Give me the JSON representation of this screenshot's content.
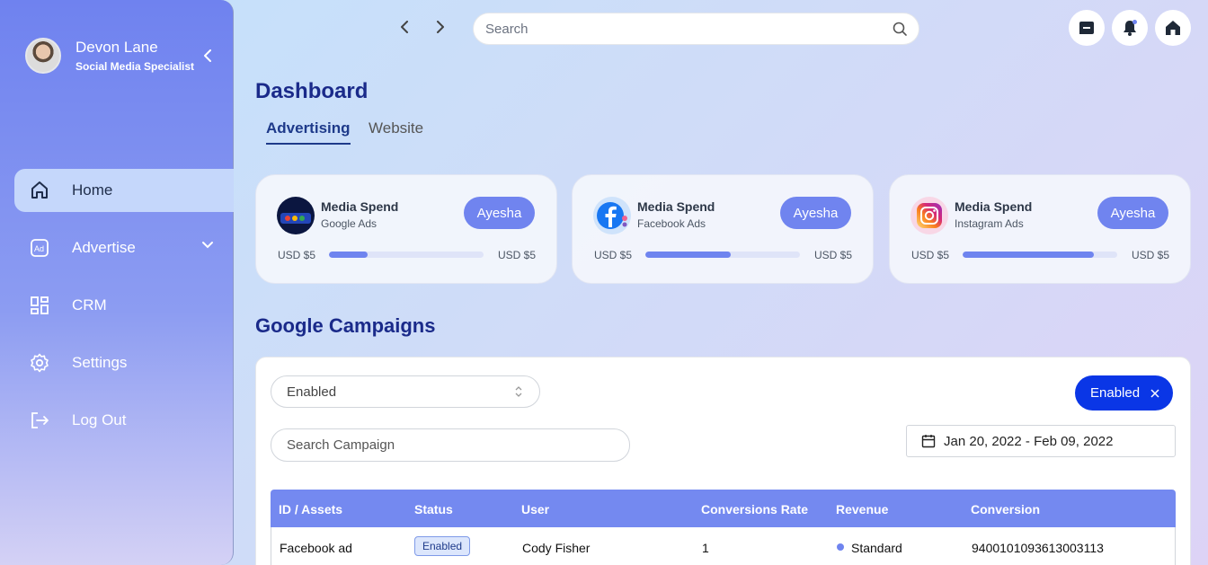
{
  "profile": {
    "name": "Devon Lane",
    "role": "Social Media Specialist"
  },
  "nav": [
    {
      "label": "Home",
      "icon": "home-icon",
      "active": true
    },
    {
      "label": "Advertise",
      "icon": "ad-icon",
      "active": false
    },
    {
      "label": "CRM",
      "icon": "grid-icon",
      "active": false
    },
    {
      "label": "Settings",
      "icon": "gear-icon",
      "active": false
    },
    {
      "label": "Log Out",
      "icon": "logout-icon",
      "active": false
    }
  ],
  "topbar": {
    "search_placeholder": "Search",
    "icons": [
      "chat-icon",
      "bell-icon",
      "home-icon"
    ]
  },
  "page": {
    "title": "Dashboard",
    "tabs": [
      {
        "label": "Advertising",
        "active": true
      },
      {
        "label": "Website",
        "active": false
      }
    ]
  },
  "cards": [
    {
      "title": "Media Spend",
      "sub": "Google Ads",
      "button": "Ayesha",
      "min": "USD $5",
      "max": "USD $5",
      "progress": 0.25,
      "logo": "google-ads-logo"
    },
    {
      "title": "Media Spend",
      "sub": "Facebook Ads",
      "button": "Ayesha",
      "min": "USD $5",
      "max": "USD $5",
      "progress": 0.55,
      "logo": "facebook-logo"
    },
    {
      "title": "Media Spend",
      "sub": "Instagram Ads",
      "button": "Ayesha",
      "min": "USD $5",
      "max": "USD $5",
      "progress": 0.85,
      "logo": "instagram-logo"
    }
  ],
  "campaigns": {
    "title": "Google Campaigns",
    "status_select": "Enabled",
    "filter_chip": "Enabled",
    "search_placeholder": "Search Campaign",
    "date_range": "Jan 20, 2022 - Feb 09, 2022",
    "columns": [
      "ID / Assets",
      "Status",
      "User",
      "Conversions Rate",
      "Revenue",
      "Conversion"
    ],
    "rows": [
      {
        "asset": "Facebook ad",
        "status": "Enabled",
        "user": "Cody Fisher",
        "rate": "1",
        "revenue": "Standard",
        "conversion": "9400101093613003113"
      }
    ]
  },
  "colors": {
    "accent": "#7084ef",
    "primary": "#0a36e6",
    "title": "#1a2a8a"
  }
}
